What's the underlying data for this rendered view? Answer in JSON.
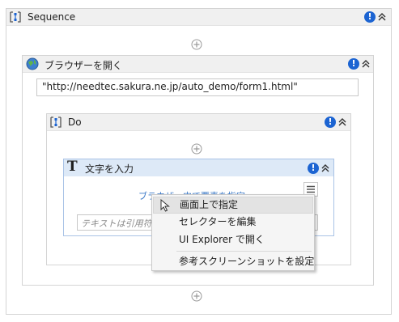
{
  "sequence": {
    "title": "Sequence"
  },
  "open_browser": {
    "title": "ブラウザーを開く",
    "url": "\"http://needtec.sakura.ne.jp/auto_demo/form1.html\""
  },
  "do_block": {
    "title": "Do"
  },
  "type_into": {
    "title": "文字を入力",
    "indicate_link": "ブラウザー内で要素を指定",
    "text_placeholder": "テキストは引用符で囲む必要があります"
  },
  "context_menu": {
    "items": [
      {
        "label": "画面上で指定"
      },
      {
        "label": "セレクターを編集"
      },
      {
        "label": "UI Explorer で開く"
      },
      {
        "label": "参考スクリーンショットを設定"
      }
    ]
  },
  "icons": {
    "warning": "!",
    "warning_color": "#1c64d2",
    "accent_blue": "#3a78c7"
  }
}
